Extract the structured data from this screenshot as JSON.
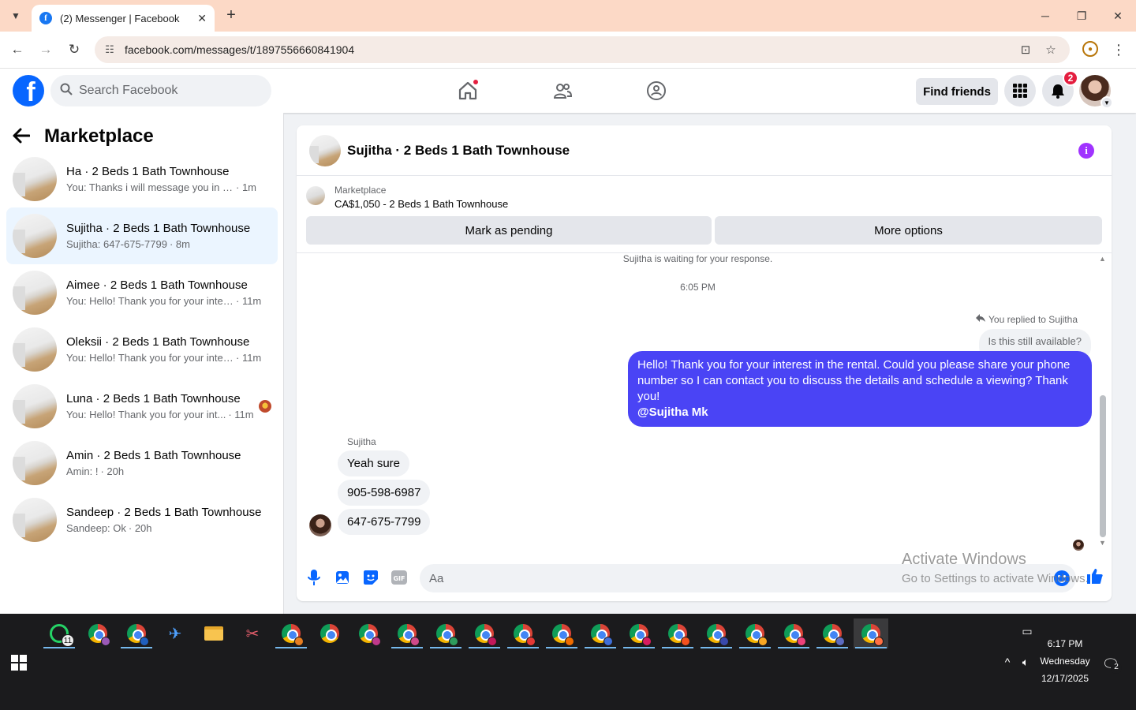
{
  "browser": {
    "tab_title": "(2) Messenger | Facebook",
    "favicon_letter": "f",
    "url": "facebook.com/messages/t/1897556660841904",
    "window_controls": {
      "minimize": "─",
      "maximize": "❐",
      "close": "✕"
    }
  },
  "fb": {
    "logo_letter": "f",
    "search_placeholder": "Search Facebook",
    "find_friends": "Find friends",
    "notification_count": "2"
  },
  "sidebar": {
    "title": "Marketplace",
    "conversations": [
      {
        "name": "Ha · 2 Beds 1 Bath Townhouse",
        "snippet": "You: Thanks i will message you in a ...",
        "time": "· 1m"
      },
      {
        "name": "Sujitha · 2 Beds 1 Bath Townhouse",
        "snippet": "Sujitha: 647-675-7799",
        "time": "· 8m"
      },
      {
        "name": "Aimee · 2 Beds 1 Bath Townhouse",
        "snippet": "You: Hello! Thank you for your inter...",
        "time": "· 11m"
      },
      {
        "name": "Oleksii · 2 Beds 1 Bath Townhouse",
        "snippet": "You: Hello! Thank you for your inter...",
        "time": "· 11m"
      },
      {
        "name": "Luna · 2 Beds 1 Bath Townhouse",
        "snippet": "You: Hello! Thank you for your int...",
        "time": "· 11m"
      },
      {
        "name": "Amin · 2 Beds 1 Bath Townhouse",
        "snippet": "Amin: !",
        "time": "· 20h"
      },
      {
        "name": "Sandeep · 2 Beds 1 Bath Townhouse",
        "snippet": "Sandeep: Ok",
        "time": "· 20h"
      }
    ]
  },
  "chat": {
    "title": "Sujitha · 2 Beds 1 Bath Townhouse",
    "marketplace_label": "Marketplace",
    "listing": "CA$1,050 - 2 Beds 1 Bath Townhouse",
    "mark_pending": "Mark as pending",
    "more_options": "More options",
    "waiting": "Sujitha is waiting for your response.",
    "timestamp": "6:05 PM",
    "replied_to": "You replied to Sujitha",
    "quoted": "Is this still available?",
    "outgoing": "Hello! Thank you for your interest in the rental. Could you please share your phone number so I can contact you to discuss the details and schedule a viewing? Thank you!",
    "mention": "@Sujitha Mk",
    "sender": "Sujitha",
    "incoming": [
      "Yeah sure",
      "905-598-6987",
      "647-675-7799"
    ],
    "composer_placeholder": "Aa"
  },
  "watermark": {
    "line1": "Activate Windows",
    "line2": "Go to Settings to activate Windows."
  },
  "taskbar": {
    "whatsapp_badge": "11",
    "clock_time": "6:17 PM",
    "clock_day": "Wednesday",
    "clock_date": "12/17/2025",
    "notif_count": "2"
  },
  "colors": {
    "fb_blue": "#0866ff",
    "outgoing_bubble": "#4a44f5",
    "active_conversation": "#ebf5ff",
    "tabbar": "#fcd9c6",
    "badge_red": "#e41e3f"
  }
}
